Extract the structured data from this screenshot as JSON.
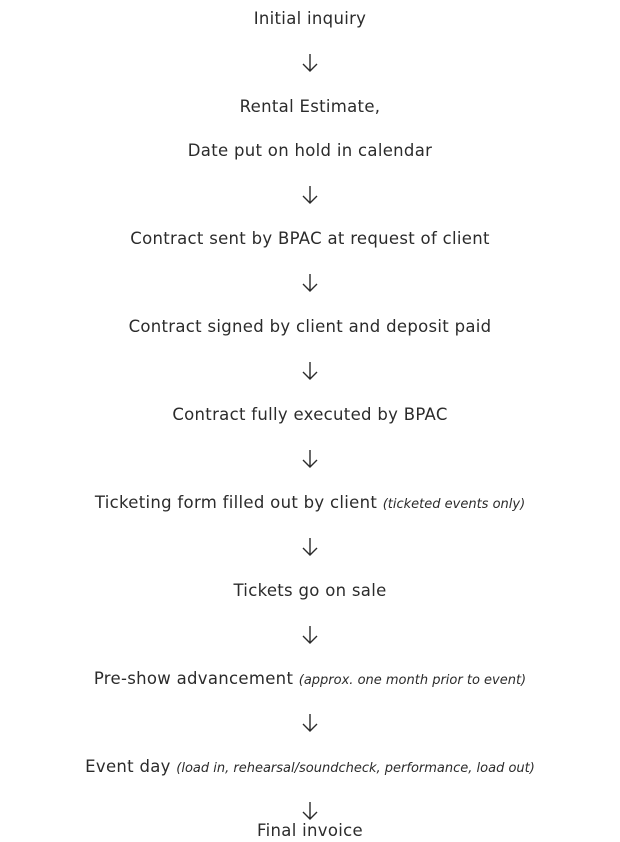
{
  "steps": [
    {
      "text": "Initial inquiry",
      "note": ""
    },
    {
      "text": "Rental Estimate,",
      "note": ""
    },
    {
      "text": "Date put on hold in calendar",
      "note": ""
    },
    {
      "text": "Contract sent by BPAC at request of client",
      "note": ""
    },
    {
      "text": "Contract signed by client and deposit paid",
      "note": ""
    },
    {
      "text": "Contract fully executed by BPAC",
      "note": ""
    },
    {
      "text": "Ticketing form filled out by client ",
      "note": "(ticketed events only)"
    },
    {
      "text": "Tickets go on sale",
      "note": ""
    },
    {
      "text": "Pre-show advancement ",
      "note": "(approx. one month prior to event)"
    },
    {
      "text": "Event day ",
      "note": "(load in, rehearsal/soundcheck, performance, load out)"
    },
    {
      "text": "Final invoice",
      "note": ""
    }
  ],
  "arrow_icon": "arrow-down-icon"
}
